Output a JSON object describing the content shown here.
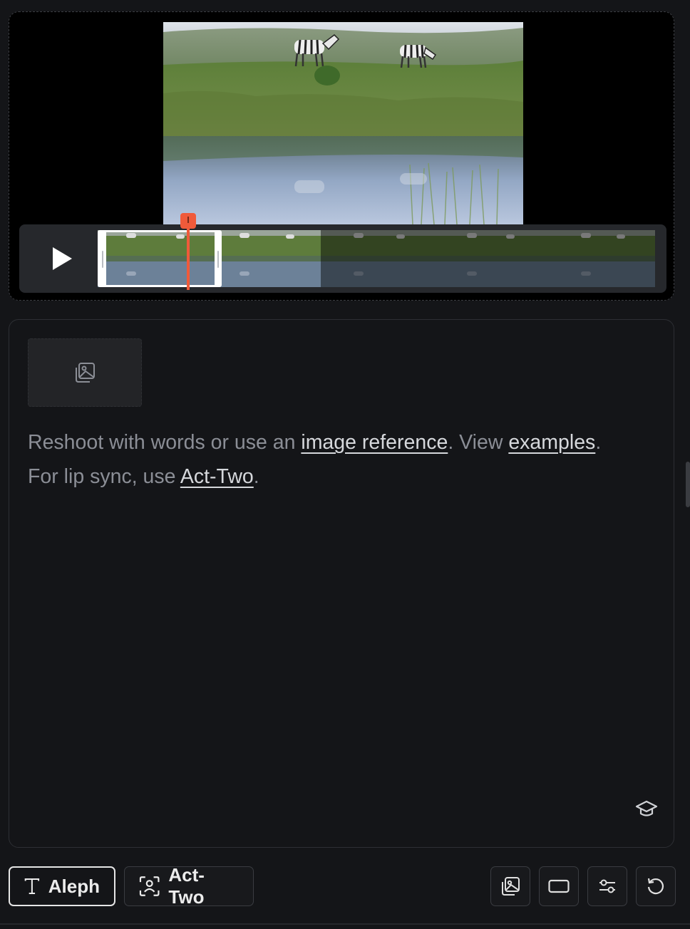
{
  "video": {
    "play_icon": "play-icon",
    "thumbnail_count": 5
  },
  "prompt": {
    "image_reference_icon": "image-stack-icon",
    "line1_before": "Reshoot with words or use an ",
    "link_image_reference": "image reference",
    "line1_middle": ". View ",
    "link_examples": "examples",
    "line1_end": ".",
    "line2_before": "For lip sync, use ",
    "link_act_two": "Act-Two",
    "line2_end": ".",
    "learn_icon": "graduation-cap-icon"
  },
  "modes": {
    "aleph_label": "Aleph",
    "act_two_label": "Act-Two"
  },
  "toolbar": {
    "icons": [
      "image-reference-icon",
      "aspect-ratio-icon",
      "settings-sliders-icon",
      "reset-icon"
    ]
  },
  "colors": {
    "accent_playhead": "#f05a3a",
    "background": "#141518"
  }
}
